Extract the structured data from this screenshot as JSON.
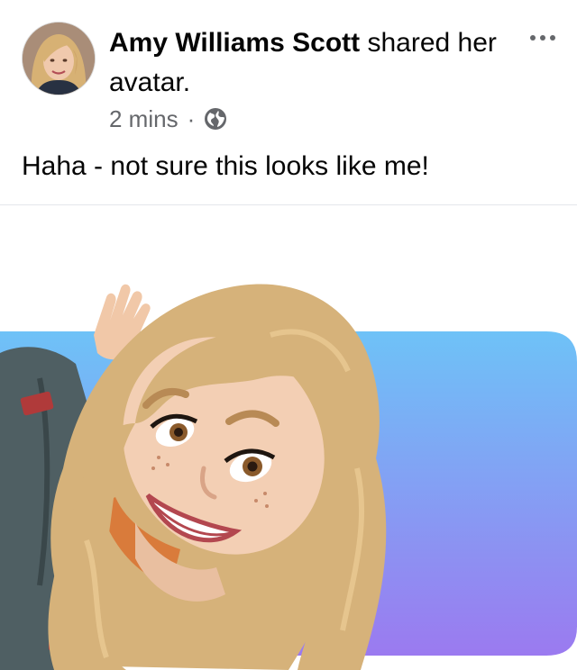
{
  "post": {
    "author": "Amy Williams Scott",
    "action": "shared her avatar.",
    "timestamp": "2 mins",
    "separator": "·",
    "privacy_icon": "globe-icon",
    "more_icon": "more-options-icon",
    "caption": "Haha - not sure this looks like me!",
    "image_description_icon": "avatar-sticker"
  },
  "colors": {
    "background": "#ffffff",
    "text": "#050505",
    "meta": "#65676b",
    "card_top": "#6ec2f7",
    "card_bottom": "#9b7af0",
    "hair": "#d6b27a",
    "skin": "#f3cfb4",
    "jacket": "#4f5f63"
  }
}
